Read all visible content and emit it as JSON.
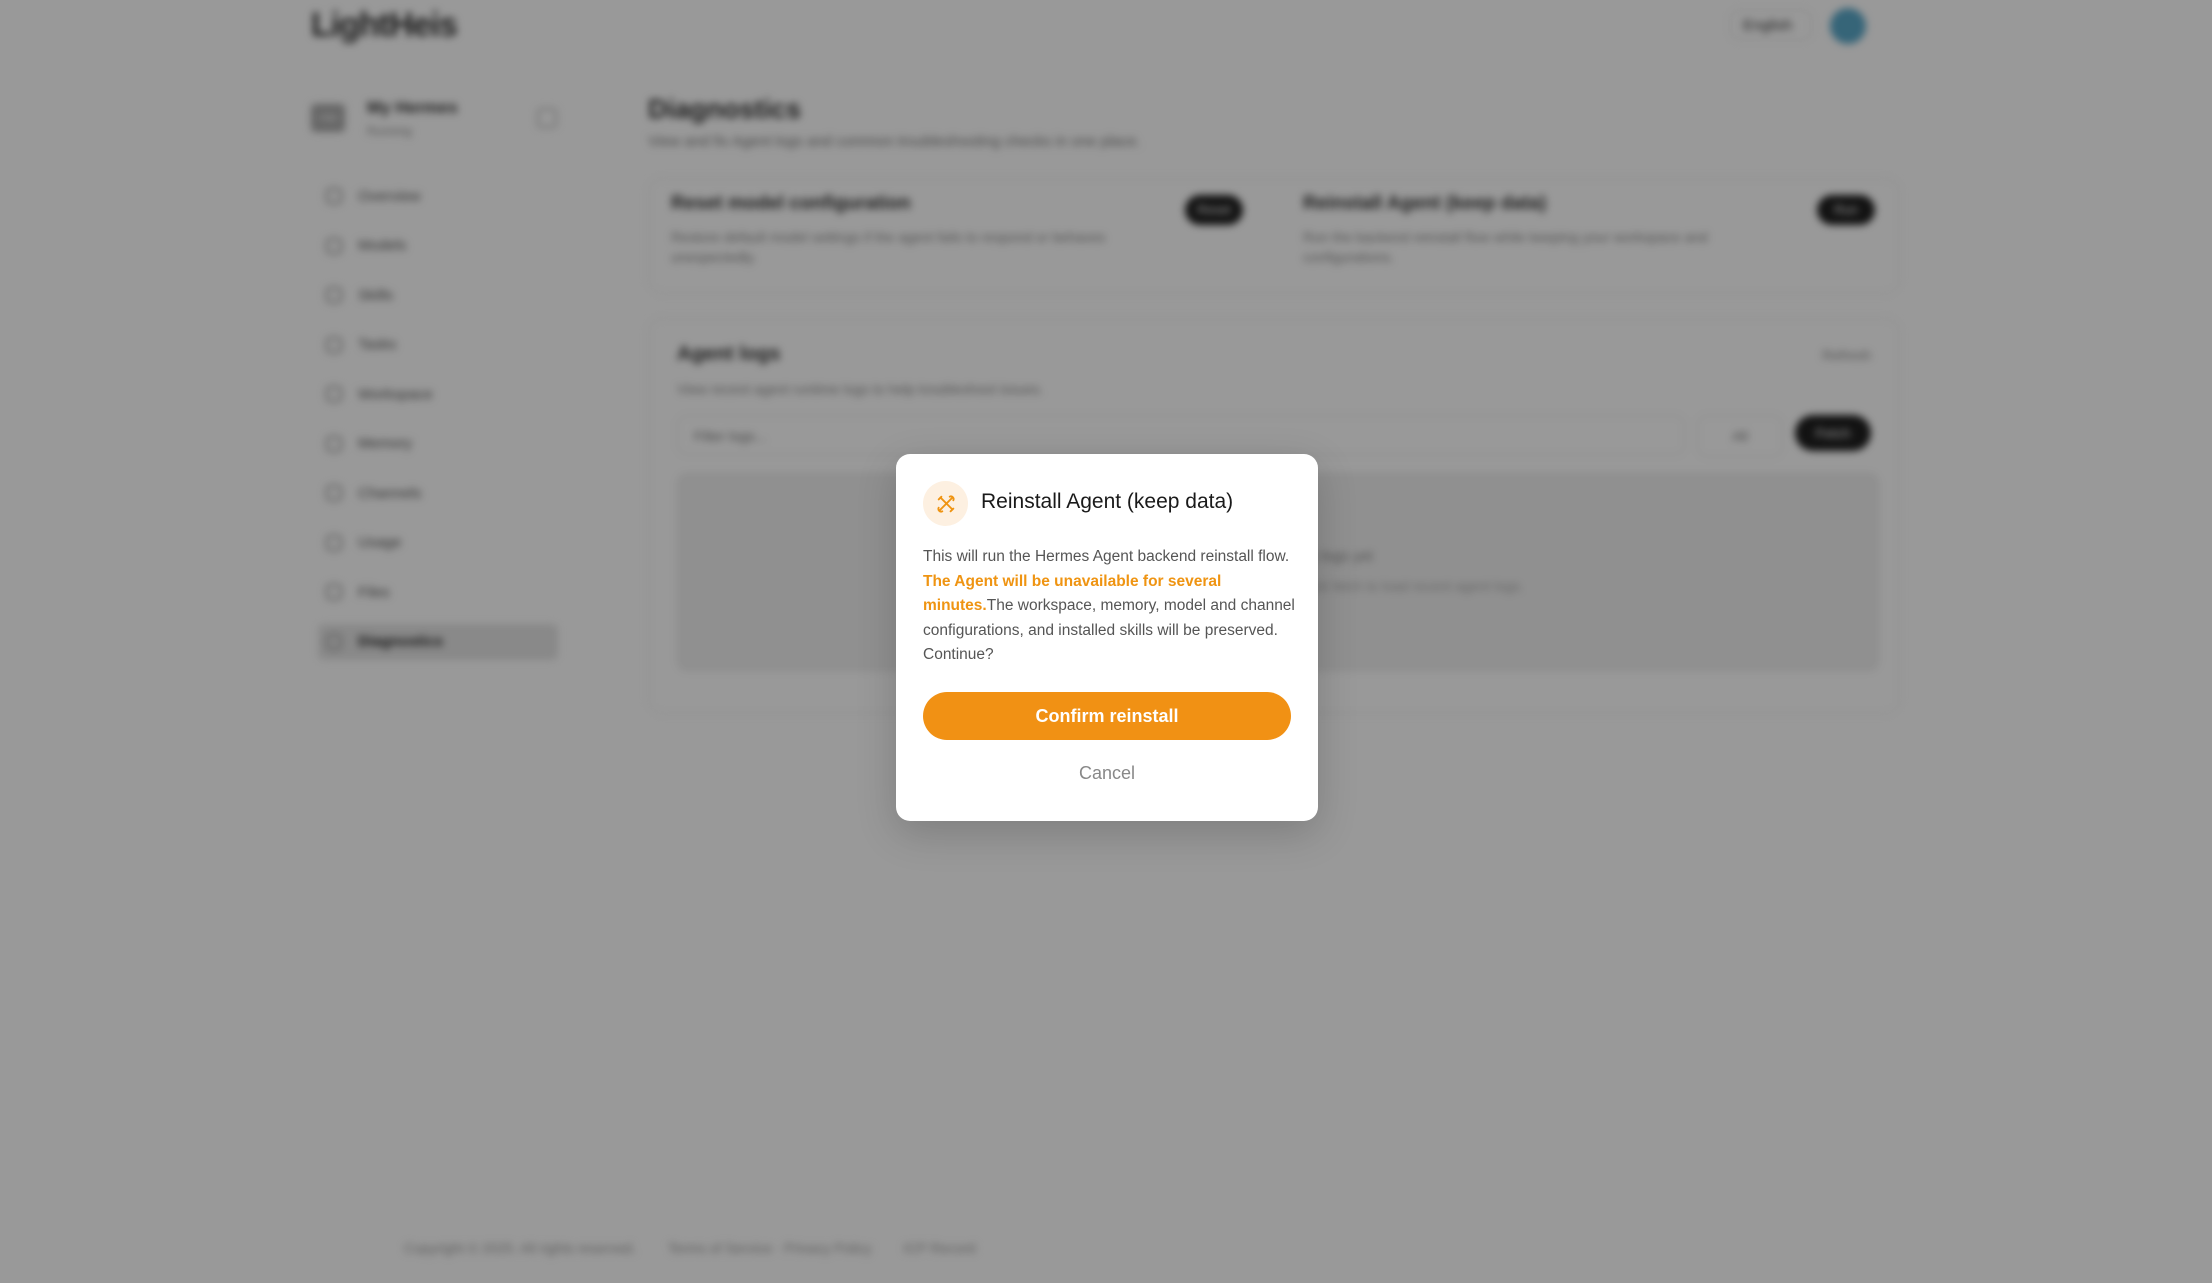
{
  "header": {
    "logo": "LightHeis",
    "language": "English",
    "avatar": "user-avatar"
  },
  "instance": {
    "name": "My Hermes",
    "sub": "Running",
    "thumb": "HM"
  },
  "sidebar": {
    "items": [
      {
        "label": "Overview",
        "icon": "overview-icon"
      },
      {
        "label": "Models",
        "icon": "models-icon"
      },
      {
        "label": "Skills",
        "icon": "skills-icon"
      },
      {
        "label": "Tasks",
        "icon": "tasks-icon"
      },
      {
        "label": "Workspace",
        "icon": "workspace-icon"
      },
      {
        "label": "Memory",
        "icon": "memory-icon"
      },
      {
        "label": "Channels",
        "icon": "channels-icon"
      },
      {
        "label": "Usage",
        "icon": "usage-icon"
      },
      {
        "label": "Files",
        "icon": "files-icon"
      },
      {
        "label": "Diagnostics",
        "icon": "diagnostics-icon",
        "active": true
      }
    ]
  },
  "page": {
    "title": "Diagnostics",
    "description": "View and fix Agent logs and common troubleshooting checks in one place."
  },
  "tools": [
    {
      "title": "Reset model configuration",
      "description": "Restore default model settings if the agent fails to respond or behaves unexpectedly.",
      "button": "Reset"
    },
    {
      "title": "Reinstall Agent (keep data)",
      "description": "Run the backend reinstall flow while keeping your workspace and configurations.",
      "button": "Run"
    }
  ],
  "logs": {
    "title": "Agent logs",
    "description": "View recent agent runtime logs to help troubleshoot issues.",
    "refresh": "Refresh",
    "filter_placeholder": "Filter logs...",
    "level": "All",
    "fetch_button": "Fetch",
    "empty": "No logs yet",
    "empty_sub": "Click fetch to load recent agent logs."
  },
  "footer": {
    "copyright": "Copyright © 2025. All rights reserved.",
    "links": "Terms of Service · Privacy Policy",
    "icp": "ICP Record"
  },
  "dialog": {
    "icon": "tools-icon",
    "title": "Reinstall Agent (keep data)",
    "body_before": "This will run the Hermes Agent backend reinstall flow. ",
    "body_warning": "The Agent will be unavailable for several minutes.",
    "body_after": "The workspace, memory, model and channel configurations, and installed skills will be preserved. Continue?",
    "confirm_label": "Confirm reinstall",
    "cancel_label": "Cancel"
  },
  "colors": {
    "accent": "#f19114",
    "warning_text": "#ef9412",
    "icon_bg": "#fdf0e1"
  }
}
